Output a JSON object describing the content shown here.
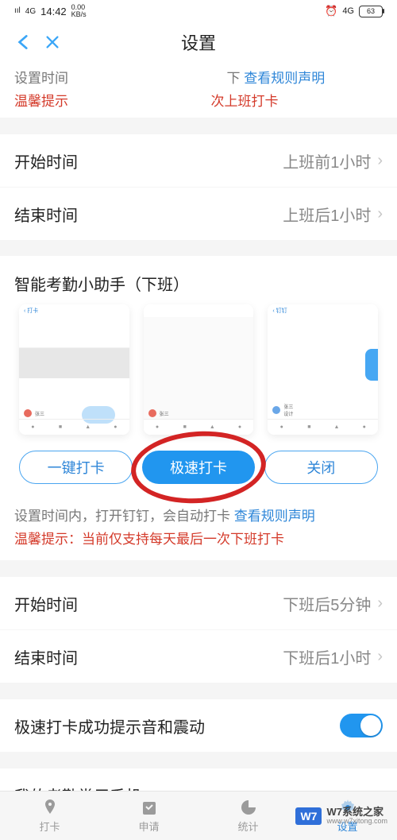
{
  "status": {
    "signal": "4G",
    "time": "14:42",
    "speed_top": "0.00",
    "speed_unit": "KB/s",
    "right_signal": "4G",
    "battery": "63"
  },
  "nav": {
    "title": "设置"
  },
  "upper": {
    "cut_prefix": "设置时间",
    "cut_suffix": "下",
    "cut_link": "查看规则声明",
    "warn_prefix": "温馨提示",
    "warn_suffix": "次上班打卡",
    "start_label": "开始时间",
    "start_value": "上班前1小时",
    "end_label": "结束时间",
    "end_value": "上班后1小时"
  },
  "assist": {
    "title": "智能考勤小助手（下班）",
    "btn_a": "一键打卡",
    "btn_b": "极速打卡",
    "btn_c": "关闭",
    "hint_text": "设置时间内，打开钉钉，会自动打卡 ",
    "hint_link": "查看规则声明",
    "hint_warn": "温馨提示：当前仅支持每天最后一次下班打卡",
    "start_label": "开始时间",
    "start_value": "下班后5分钟",
    "end_label": "结束时间",
    "end_value": "下班后1小时"
  },
  "rows": {
    "sound": "极速打卡成功提示音和震动",
    "phones": "我的考勤常用手机"
  },
  "tabs": {
    "a": "打卡",
    "b": "申请",
    "c": "统计",
    "d": "设置"
  },
  "wm": {
    "badge": "W7",
    "t1": "W7系统之家",
    "t2": "www.w7xitong.com"
  }
}
